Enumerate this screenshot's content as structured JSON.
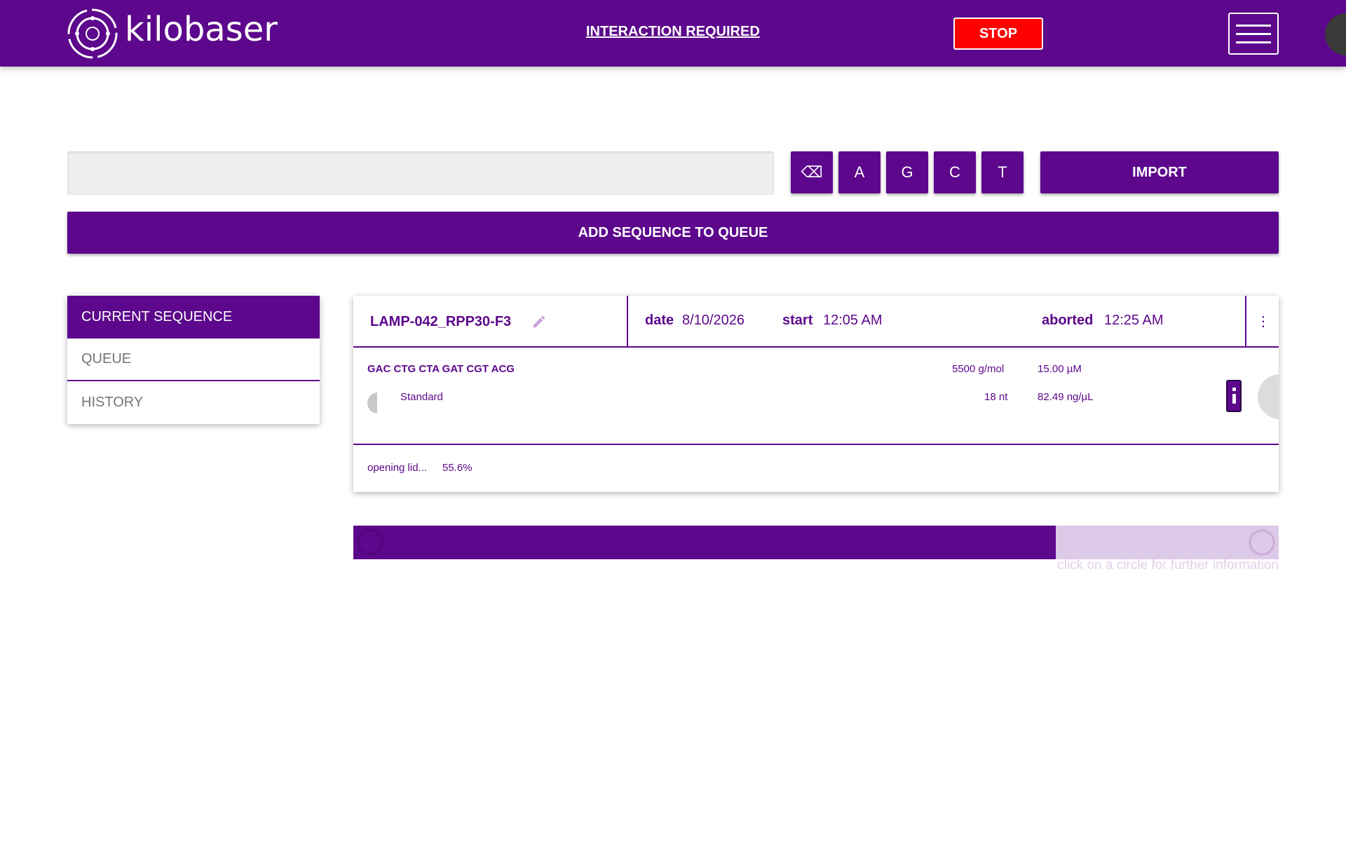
{
  "header": {
    "logo_text": "kilobaser",
    "interaction_link": "INTERACTION REQUIRED",
    "stop_label": "STOP",
    "brand_color": "#5c078c",
    "stop_color": "#ff0000"
  },
  "input": {
    "value": "",
    "placeholder": ""
  },
  "keys": {
    "backspace": "⌫",
    "a": "A",
    "g": "G",
    "c": "C",
    "t": "T"
  },
  "import_label": "IMPORT",
  "add_label": "ADD SEQUENCE TO QUEUE",
  "sidenav": {
    "items": [
      {
        "label": "CURRENT SEQUENCE",
        "active": true
      },
      {
        "label": "QUEUE",
        "active": false
      },
      {
        "label": "HISTORY",
        "active": false
      }
    ]
  },
  "card": {
    "name": "LAMP-042_RPP30-F3",
    "date_label": "date",
    "date_value": "8/10/2026",
    "start_label": "start",
    "start_value": "12:05 AM",
    "aborted_label": "aborted",
    "aborted_value": "12:25 AM",
    "sequence": "GAC CTG CTA GAT CGT ACG",
    "type": "Standard",
    "mass": "5500 g/mol",
    "length": "18 nt",
    "concentration": "15.00 µM",
    "amount": "82.49 ng/µL",
    "status_text": "opening lid...",
    "status_percent": "55.6%"
  },
  "progress": {
    "value": 0.759,
    "hint": "click on a circle for further information"
  }
}
